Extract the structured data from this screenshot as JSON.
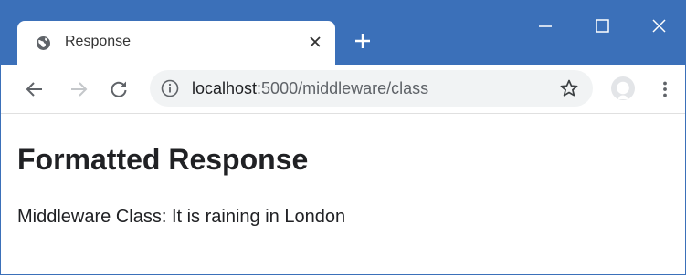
{
  "tab": {
    "title": "Response"
  },
  "address_bar": {
    "host": "localhost",
    "rest": ":5000/middleware/class"
  },
  "page": {
    "heading": "Formatted Response",
    "message": "Middleware Class: It is raining in London"
  },
  "icons": {
    "favicon": "globe-icon",
    "tab_close": "close-icon",
    "new_tab": "plus-icon",
    "minimize": "minimize-icon",
    "maximize": "maximize-icon",
    "close": "close-icon",
    "back": "arrow-left-icon",
    "forward": "arrow-right-icon",
    "reload": "reload-icon",
    "site_info": "info-icon",
    "bookmark": "star-icon",
    "profile": "avatar-icon",
    "menu": "kebab-menu-icon"
  },
  "colors": {
    "titlebar": "#3b70b9",
    "toolbar": "#ffffff",
    "omnibox": "#f1f3f4"
  }
}
